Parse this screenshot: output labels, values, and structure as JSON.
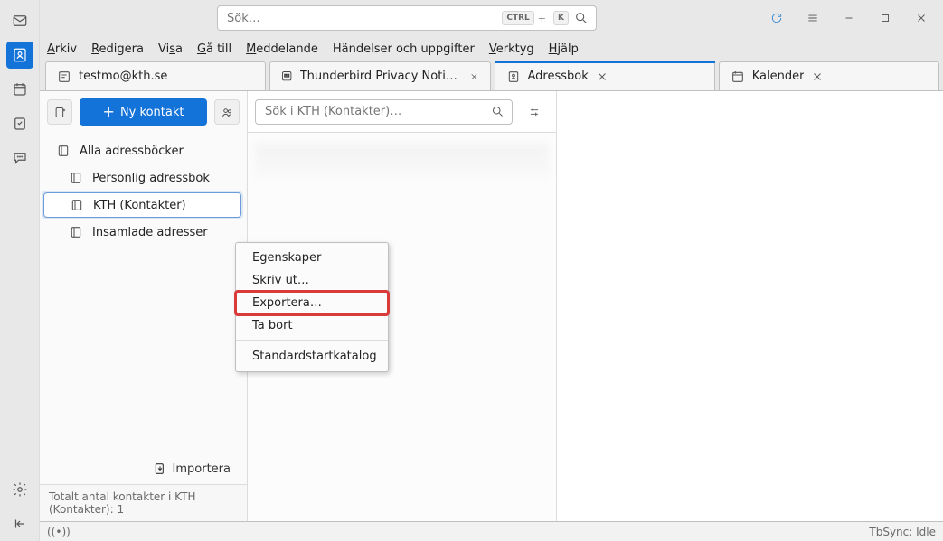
{
  "global_search": {
    "placeholder": "Sök…",
    "kbd1": "CTRL",
    "kbd2": "K"
  },
  "menubar": {
    "file": "Arkiv",
    "edit": "Redigera",
    "view": "Visa",
    "go": "Gå till",
    "message": "Meddelande",
    "events": "Händelser och uppgifter",
    "tools": "Verktyg",
    "help": "Hjälp"
  },
  "tabs": [
    {
      "label": "testmo@kth.se"
    },
    {
      "label": "Thunderbird Privacy Notice — Mo…"
    },
    {
      "label": "Adressbok"
    },
    {
      "label": "Kalender"
    }
  ],
  "sidebar": {
    "new_contact": "Ny kontakt",
    "items": [
      {
        "label": "Alla adressböcker"
      },
      {
        "label": "Personlig adressbok"
      },
      {
        "label": "KTH (Kontakter)"
      },
      {
        "label": "Insamlade adresser"
      }
    ],
    "import": "Importera",
    "status": "Totalt antal kontakter i KTH (Kontakter): 1"
  },
  "mid": {
    "search_placeholder": "Sök i KTH (Kontakter)…"
  },
  "context_menu": {
    "properties": "Egenskaper",
    "print": "Skriv ut…",
    "export": "Exportera…",
    "delete": "Ta bort",
    "default_dir": "Standardstartkatalog"
  },
  "statusbar": {
    "tbsync": "TbSync: Idle"
  }
}
